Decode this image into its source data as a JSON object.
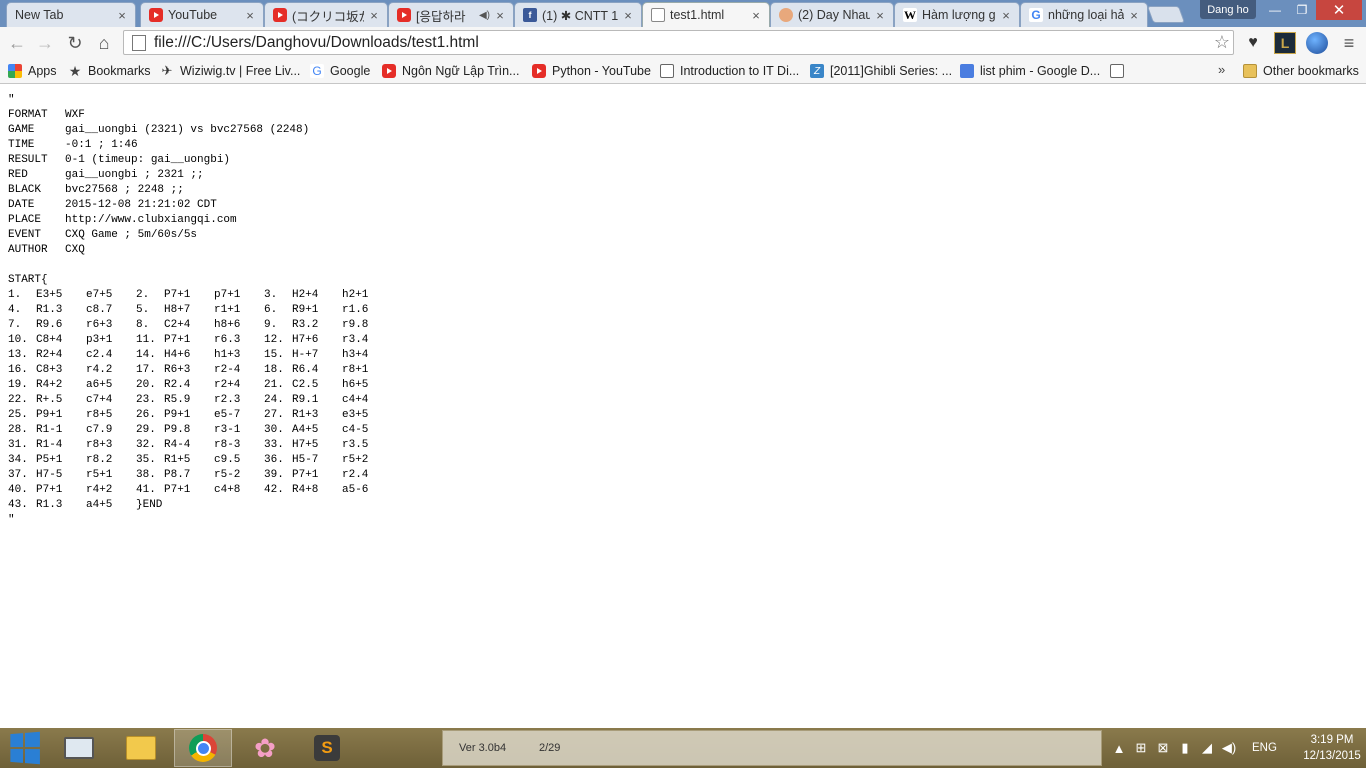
{
  "browser": {
    "tabs": [
      {
        "title": "New Tab",
        "favicon": "none",
        "active": false
      },
      {
        "title": "YouTube",
        "favicon": "youtube-icon",
        "active": false
      },
      {
        "title": "(コクリコ坂から)",
        "favicon": "youtube-icon",
        "active": false
      },
      {
        "title": "[응답하라",
        "favicon": "youtube-icon",
        "active": false,
        "audio": true
      },
      {
        "title": "(1) ✱ CNTT 1",
        "favicon": "facebook-icon",
        "active": false
      },
      {
        "title": "test1.html",
        "favicon": "document-icon",
        "active": true
      },
      {
        "title": "(2) Day Nhau",
        "favicon": "face-icon",
        "active": false
      },
      {
        "title": "Hàm lượng gi",
        "favicon": "wikipedia-icon",
        "active": false
      },
      {
        "title": "những loại hả",
        "favicon": "google-icon",
        "active": false
      }
    ],
    "profile_name": "Dang ho",
    "window_buttons": {
      "minimize": "—",
      "maximize": "❐",
      "close": "✕"
    },
    "url": "file:///C:/Users/Danghovu/Downloads/test1.html",
    "nav": {
      "back": "←",
      "forward": "→",
      "reload": "↻",
      "home": "⌂",
      "star": "☆",
      "menu": "≡"
    },
    "extensions": {
      "heart": "♥",
      "lol": "L",
      "globe": "◉"
    },
    "bookmarks": [
      {
        "label": "Apps",
        "icon": "apps-icon"
      },
      {
        "label": "Bookmarks",
        "icon": "star-icon"
      },
      {
        "label": "Wiziwig.tv | Free Liv...",
        "icon": "wiziwig-icon"
      },
      {
        "label": "Google",
        "icon": "google-icon"
      },
      {
        "label": "Ngôn Ngữ Lập Trìn...",
        "icon": "youtube-icon"
      },
      {
        "label": "Python - YouTube",
        "icon": "youtube-icon"
      },
      {
        "label": "Introduction to IT Di...",
        "icon": "page-icon"
      },
      {
        "label": "[2011]Ghibli Series: ...",
        "icon": "ghibli-icon"
      },
      {
        "label": "list phim - Google D...",
        "icon": "doc-icon"
      },
      {
        "label": "",
        "icon": "blank-page-icon"
      }
    ],
    "bookmarks_more": "»",
    "other_bookmarks": "Other bookmarks"
  },
  "document": {
    "open_quote": "\"",
    "close_quote": "\"",
    "header": [
      {
        "key": "FORMAT",
        "value": "WXF"
      },
      {
        "key": "GAME",
        "value": "gai__uongbi (2321) vs bvc27568 (2248)"
      },
      {
        "key": "TIME",
        "value": "-0:1 ; 1:46"
      },
      {
        "key": "RESULT",
        "value": "0-1 (timeup: gai__uongbi)"
      },
      {
        "key": "RED",
        "value": "gai__uongbi ; 2321 ;;"
      },
      {
        "key": "BLACK",
        "value": "bvc27568 ; 2248 ;;"
      },
      {
        "key": "DATE",
        "value": "2015-12-08 21:21:02 CDT"
      },
      {
        "key": "PLACE",
        "value": "http://www.clubxiangqi.com"
      },
      {
        "key": "EVENT",
        "value": "CXQ Game ; 5m/60s/5s"
      },
      {
        "key": "AUTHOR",
        "value": "CXQ"
      }
    ],
    "start": "START{",
    "moves": [
      [
        "1.",
        "E3+5",
        "e7+5"
      ],
      [
        "2.",
        "P7+1",
        "p7+1"
      ],
      [
        "3.",
        "H2+4",
        "h2+1"
      ],
      [
        "4.",
        "R1.3",
        "c8.7"
      ],
      [
        "5.",
        "H8+7",
        "r1+1"
      ],
      [
        "6.",
        "R9+1",
        "r1.6"
      ],
      [
        "7.",
        "R9.6",
        "r6+3"
      ],
      [
        "8.",
        "C2+4",
        "h8+6"
      ],
      [
        "9.",
        "R3.2",
        "r9.8"
      ],
      [
        "10.",
        "C8+4",
        "p3+1"
      ],
      [
        "11.",
        "P7+1",
        "r6.3"
      ],
      [
        "12.",
        "H7+6",
        "r3.4"
      ],
      [
        "13.",
        "R2+4",
        "c2.4"
      ],
      [
        "14.",
        "H4+6",
        "h1+3"
      ],
      [
        "15.",
        "H-+7",
        "h3+4"
      ],
      [
        "16.",
        "C8+3",
        "r4.2"
      ],
      [
        "17.",
        "R6+3",
        "r2-4"
      ],
      [
        "18.",
        "R6.4",
        "r8+1"
      ],
      [
        "19.",
        "R4+2",
        "a6+5"
      ],
      [
        "20.",
        "R2.4",
        "r2+4"
      ],
      [
        "21.",
        "C2.5",
        "h6+5"
      ],
      [
        "22.",
        "R+.5",
        "c7+4"
      ],
      [
        "23.",
        "R5.9",
        "r2.3"
      ],
      [
        "24.",
        "R9.1",
        "c4+4"
      ],
      [
        "25.",
        "P9+1",
        "r8+5"
      ],
      [
        "26.",
        "P9+1",
        "e5-7"
      ],
      [
        "27.",
        "R1+3",
        "e3+5"
      ],
      [
        "28.",
        "R1-1",
        "c7.9"
      ],
      [
        "29.",
        "P9.8",
        "r3-1"
      ],
      [
        "30.",
        "A4+5",
        "c4-5"
      ],
      [
        "31.",
        "R1-4",
        "r8+3"
      ],
      [
        "32.",
        "R4-4",
        "r8-3"
      ],
      [
        "33.",
        "H7+5",
        "r3.5"
      ],
      [
        "34.",
        "P5+1",
        "r8.2"
      ],
      [
        "35.",
        "R1+5",
        "c9.5"
      ],
      [
        "36.",
        "H5-7",
        "r5+2"
      ],
      [
        "37.",
        "H7-5",
        "r5+1"
      ],
      [
        "38.",
        "P8.7",
        "r5-2"
      ],
      [
        "39.",
        "P7+1",
        "r2.4"
      ],
      [
        "40.",
        "P7+1",
        "r4+2"
      ],
      [
        "41.",
        "P7+1",
        "c4+8"
      ],
      [
        "42.",
        "R4+8",
        "a5-6"
      ],
      [
        "43.",
        "R1.3",
        "a4+5"
      ]
    ],
    "end": "}END"
  },
  "taskbar": {
    "items": [
      "start-button",
      "resource-monitor-icon",
      "file-explorer-icon",
      "chrome-icon",
      "sakura-icon",
      "sublime-text-icon"
    ],
    "toolbar_version": "Ver 3.0b4",
    "toolbar_pages": "2/29",
    "language": "ENG",
    "time": "3:19 PM",
    "date": "12/13/2015"
  }
}
